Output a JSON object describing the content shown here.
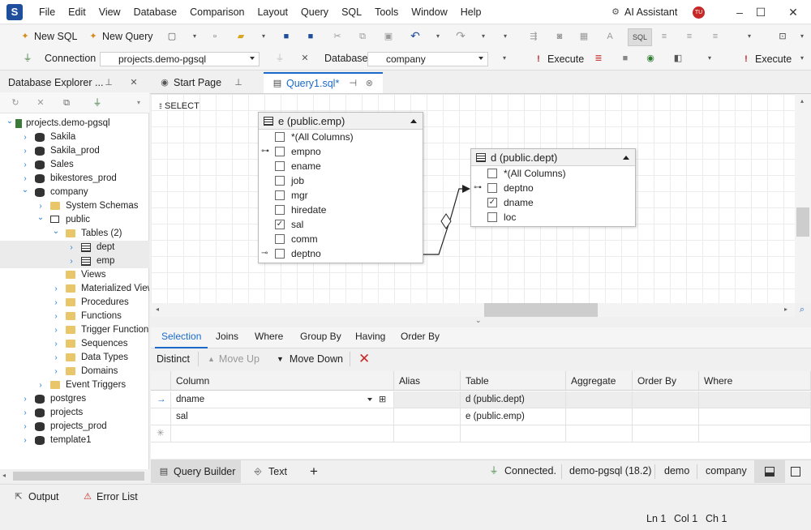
{
  "app": {
    "logo_letter": "S"
  },
  "menu": [
    "File",
    "Edit",
    "View",
    "Database",
    "Comparison",
    "Layout",
    "Query",
    "SQL",
    "Tools",
    "Window",
    "Help"
  ],
  "ai": {
    "label": "AI Assistant",
    "badge": "TU"
  },
  "window_controls": {
    "minimize": "–",
    "maximize": "☐",
    "close": "✕"
  },
  "toolbar1": {
    "new_sql": "New SQL",
    "new_query": "New Query"
  },
  "toolbar2": {
    "connection_label": "Connection",
    "connection_value": "projects.demo-pgsql",
    "database_label": "Database",
    "database_value": "company",
    "execute1": "Execute",
    "execute2": "Execute"
  },
  "explorer": {
    "title": "Database Explorer ...",
    "tree": [
      {
        "label": "projects.demo-pgsql",
        "level": 0,
        "icon": "plug",
        "expander": "open"
      },
      {
        "label": "Sakila",
        "level": 1,
        "icon": "db",
        "expander": "closed"
      },
      {
        "label": "Sakila_prod",
        "level": 1,
        "icon": "db",
        "expander": "closed"
      },
      {
        "label": "Sales",
        "level": 1,
        "icon": "db",
        "expander": "closed"
      },
      {
        "label": "bikestores_prod",
        "level": 1,
        "icon": "db",
        "expander": "closed"
      },
      {
        "label": "company",
        "level": 1,
        "icon": "db",
        "expander": "open"
      },
      {
        "label": "System Schemas",
        "level": 2,
        "icon": "folder",
        "expander": "closed"
      },
      {
        "label": "public",
        "level": 2,
        "icon": "schema",
        "expander": "open"
      },
      {
        "label": "Tables (2)",
        "level": 3,
        "icon": "folder",
        "expander": "open"
      },
      {
        "label": "dept",
        "level": 4,
        "icon": "table",
        "expander": "closed",
        "selected": true
      },
      {
        "label": "emp",
        "level": 4,
        "icon": "table",
        "expander": "closed",
        "selected": true
      },
      {
        "label": "Views",
        "level": 3,
        "icon": "folder",
        "expander": "none"
      },
      {
        "label": "Materialized View",
        "level": 3,
        "icon": "folder",
        "expander": "closed"
      },
      {
        "label": "Procedures",
        "level": 3,
        "icon": "folder",
        "expander": "closed"
      },
      {
        "label": "Functions",
        "level": 3,
        "icon": "folder",
        "expander": "closed"
      },
      {
        "label": "Trigger Function",
        "level": 3,
        "icon": "folder",
        "expander": "closed"
      },
      {
        "label": "Sequences",
        "level": 3,
        "icon": "folder",
        "expander": "closed"
      },
      {
        "label": "Data Types",
        "level": 3,
        "icon": "folder",
        "expander": "closed"
      },
      {
        "label": "Domains",
        "level": 3,
        "icon": "folder",
        "expander": "closed"
      },
      {
        "label": "Event Triggers",
        "level": 2,
        "icon": "folder",
        "expander": "closed"
      },
      {
        "label": "postgres",
        "level": 1,
        "icon": "db",
        "expander": "closed"
      },
      {
        "label": "projects",
        "level": 1,
        "icon": "db",
        "expander": "closed"
      },
      {
        "label": "projects_prod",
        "level": 1,
        "icon": "db",
        "expander": "closed"
      },
      {
        "label": "template1",
        "level": 1,
        "icon": "db",
        "expander": "closed"
      }
    ]
  },
  "doc_tabs": {
    "start_page": "Start Page",
    "query1": "Query1.sql*"
  },
  "canvas": {
    "select_label": "SELECT",
    "emp_table": {
      "title": "e (public.emp)",
      "fields": [
        {
          "name": "*(All Columns)",
          "checked": false,
          "key": ""
        },
        {
          "name": "empno",
          "checked": false,
          "key": "pk"
        },
        {
          "name": "ename",
          "checked": false,
          "key": ""
        },
        {
          "name": "job",
          "checked": false,
          "key": ""
        },
        {
          "name": "mgr",
          "checked": false,
          "key": ""
        },
        {
          "name": "hiredate",
          "checked": false,
          "key": ""
        },
        {
          "name": "sal",
          "checked": true,
          "key": ""
        },
        {
          "name": "comm",
          "checked": false,
          "key": ""
        },
        {
          "name": "deptno",
          "checked": false,
          "key": "fk"
        }
      ]
    },
    "dept_table": {
      "title": "d (public.dept)",
      "fields": [
        {
          "name": "*(All Columns)",
          "checked": false,
          "key": ""
        },
        {
          "name": "deptno",
          "checked": false,
          "key": "pk"
        },
        {
          "name": "dname",
          "checked": true,
          "key": ""
        },
        {
          "name": "loc",
          "checked": false,
          "key": ""
        }
      ]
    }
  },
  "query_tabs": [
    "Selection",
    "Joins",
    "Where",
    "Group By",
    "Having",
    "Order By"
  ],
  "selection_toolbar": {
    "distinct": "Distinct",
    "move_up": "Move Up",
    "move_down": "Move Down"
  },
  "grid": {
    "columns": [
      "Column",
      "Alias",
      "Table",
      "Aggregate",
      "Order By",
      "Where"
    ],
    "rows": [
      {
        "column": "dname",
        "alias": "",
        "table": "d (public.dept)",
        "aggregate": "",
        "order_by": "",
        "where": ""
      },
      {
        "column": "sal",
        "alias": "",
        "table": "e (public.emp)",
        "aggregate": "",
        "order_by": "",
        "where": ""
      }
    ]
  },
  "bottom_tabs": {
    "query_builder": "Query Builder",
    "text": "Text",
    "add": "+"
  },
  "connection_status": {
    "state": "Connected.",
    "server": "demo-pgsql (18.2)",
    "user": "demo",
    "database": "company"
  },
  "output_bar": {
    "output": "Output",
    "error_list": "Error List"
  },
  "status": {
    "ln": "Ln 1",
    "col": "Col 1",
    "ch": "Ch 1"
  },
  "colors": {
    "accent": "#1b6ac9",
    "logo": "#1f4e9c",
    "error_red": "#c62828",
    "connected_green": "#2e7d32"
  }
}
